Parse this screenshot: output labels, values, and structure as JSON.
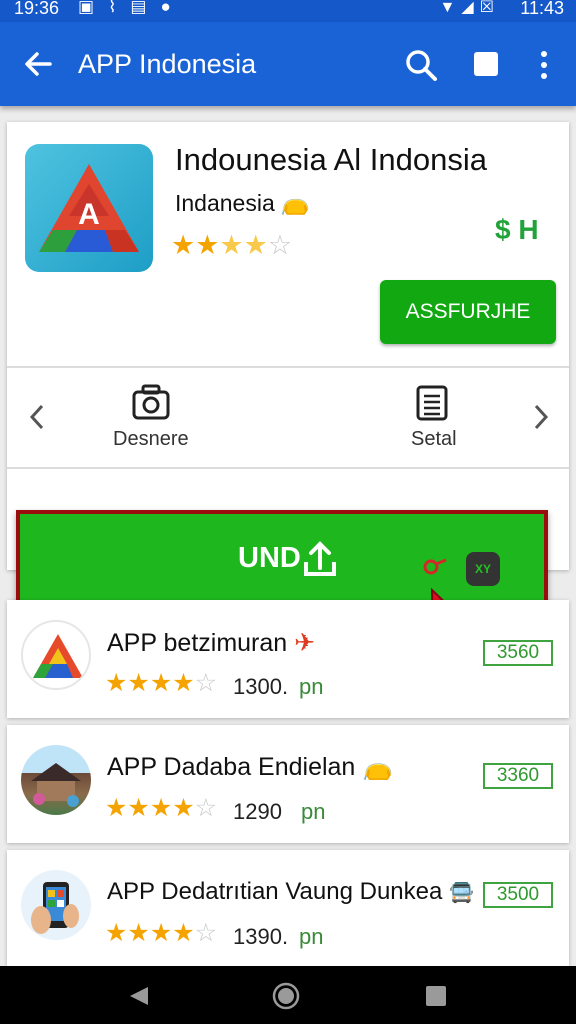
{
  "status": {
    "time_left": "19:36",
    "time_right": "11:43",
    "left_icons": [
      "photo-icon",
      "signal-icon",
      "sim-icon",
      "location-icon"
    ],
    "right_icons": [
      "wifi-icon",
      "signal-bars-icon",
      "no-sim-icon"
    ]
  },
  "appbar": {
    "title": "APP Indonesia",
    "icons": [
      "arrow-left-icon",
      "search-icon",
      "square-icon",
      "more-vertical-icon"
    ],
    "color": "#1a63d6"
  },
  "app": {
    "name": "Indounesia Al Indonsia",
    "developer": "Indanesia",
    "developer_emoji": "👝",
    "rating": 2.5,
    "rating_stars": "★★★★☆",
    "price": "$ H",
    "install_label": "ASSFURJHE",
    "install_color": "#12a812",
    "actions": [
      {
        "icon": "camera-icon",
        "label": "Desnere"
      },
      {
        "icon": "document-icon",
        "label": "Setal"
      }
    ]
  },
  "upload": {
    "label": "UND",
    "color": "#1eb81e",
    "border_color": "#9a0d0d",
    "badge_text": "XY"
  },
  "list": [
    {
      "name": "APP betzimuran",
      "emoji": "✈",
      "stars_on": "★★★★",
      "stars_off": "☆",
      "count": "1300.",
      "unit": "pn",
      "price": "3560",
      "icon": "triangle-logo-icon"
    },
    {
      "name": "APP Dadaba Endielan",
      "emoji": "👝",
      "stars_on": "★★★★",
      "stars_off": "☆",
      "count": "1290",
      "unit": "pn",
      "price": "3360",
      "icon": "village-photo-icon"
    },
    {
      "name": "APP Dedatrıtian Vaung Dunkea",
      "emoji": "🚍",
      "stars_on": "★★★★",
      "stars_off": "☆",
      "count": "1390.",
      "unit": "pn",
      "price": "3500",
      "icon": "phone-hand-icon"
    }
  ],
  "navbar": {
    "icons": [
      "nav-back-icon",
      "nav-home-icon",
      "nav-recent-icon"
    ]
  }
}
